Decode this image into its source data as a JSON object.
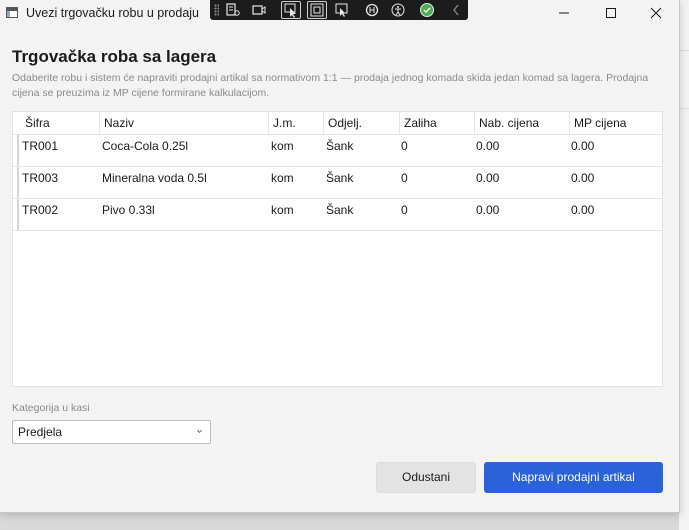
{
  "window": {
    "title": "Uvezi trgovačku robu u prodaju"
  },
  "devtools": {
    "icons": [
      "live-visual-tree-icon",
      "camera-icon",
      "select-element-icon",
      "display-layout-adorners-icon",
      "track-focus-icon",
      "hot-reload-icon",
      "accessibility-icon",
      "binding-check-icon",
      "collapse-chevron-icon"
    ]
  },
  "dialog": {
    "heading": "Trgovačka roba sa lagera",
    "description": "Odaberite robu i sistem će napraviti prodajni artikal sa normativom 1:1 — prodaja jednog komada skida jedan komad sa lagera. Prodajna cijena se preuzima iz MP cijene formirane kalkulacijom."
  },
  "table": {
    "columns": [
      "Šifra",
      "Naziv",
      "J.m.",
      "Odjelj.",
      "Zaliha",
      "Nab. cijena",
      "MP cijena"
    ],
    "rows": [
      [
        "TR001",
        "Coca-Cola 0.25l",
        "kom",
        "Šank",
        "0",
        "0.00",
        "0.00"
      ],
      [
        "TR003",
        "Mineralna voda 0.5l",
        "kom",
        "Šank",
        "0",
        "0.00",
        "0.00"
      ],
      [
        "TR002",
        "Pivo 0.33l",
        "kom",
        "Šank",
        "0",
        "0.00",
        "0.00"
      ]
    ]
  },
  "category": {
    "label": "Kategorija u kasi",
    "selected": "Predjela"
  },
  "buttons": {
    "cancel": "Odustani",
    "primary": "Napravi prodajni artikal"
  },
  "colors": {
    "accent": "#2b62d9",
    "window_bg": "#f3f3f3",
    "devbar_bg": "#1c1c1c",
    "check_green": "#4caf50"
  }
}
